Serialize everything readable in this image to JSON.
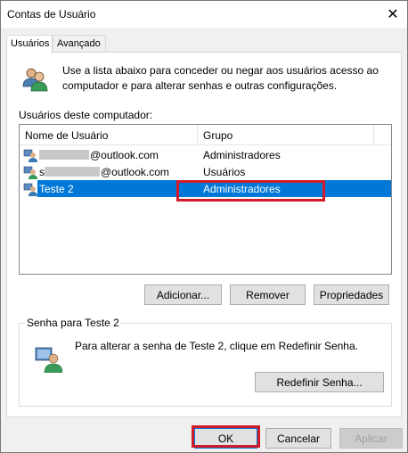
{
  "window": {
    "title": "Contas de Usuário",
    "close_glyph": "✕"
  },
  "tabs": [
    {
      "label": "Usuários",
      "active": true
    },
    {
      "label": "Avançado",
      "active": false
    }
  ],
  "intro": {
    "icon": "users-icon",
    "text": "Use a lista abaixo para conceder ou negar aos usuários acesso ao computador e para alterar senhas e outras configurações."
  },
  "users_section": {
    "label": "Usuários deste computador:",
    "columns": [
      "Nome de Usuário",
      "Grupo"
    ],
    "rows": [
      {
        "user_visible": "@outlook.com",
        "user_prefix_visible": "",
        "group": "Administradores",
        "selected": false
      },
      {
        "user_visible": "@outlook.com",
        "user_prefix_visible": "s",
        "group": "Usuários",
        "selected": false
      },
      {
        "user_visible": "Teste 2",
        "user_prefix_visible": "",
        "group": "Administradores",
        "selected": true
      }
    ]
  },
  "buttons": {
    "add": "Adicionar...",
    "remove": "Remover",
    "properties": "Propriedades",
    "reset_password": "Redefinir Senha...",
    "ok": "OK",
    "cancel": "Cancelar",
    "apply": "Aplicar"
  },
  "password_group": {
    "legend": "Senha para Teste 2",
    "text": "Para alterar a senha de Teste 2, clique em Redefinir Senha."
  },
  "colors": {
    "selection": "#0078d7",
    "highlight_annotation": "#d11b2a"
  }
}
